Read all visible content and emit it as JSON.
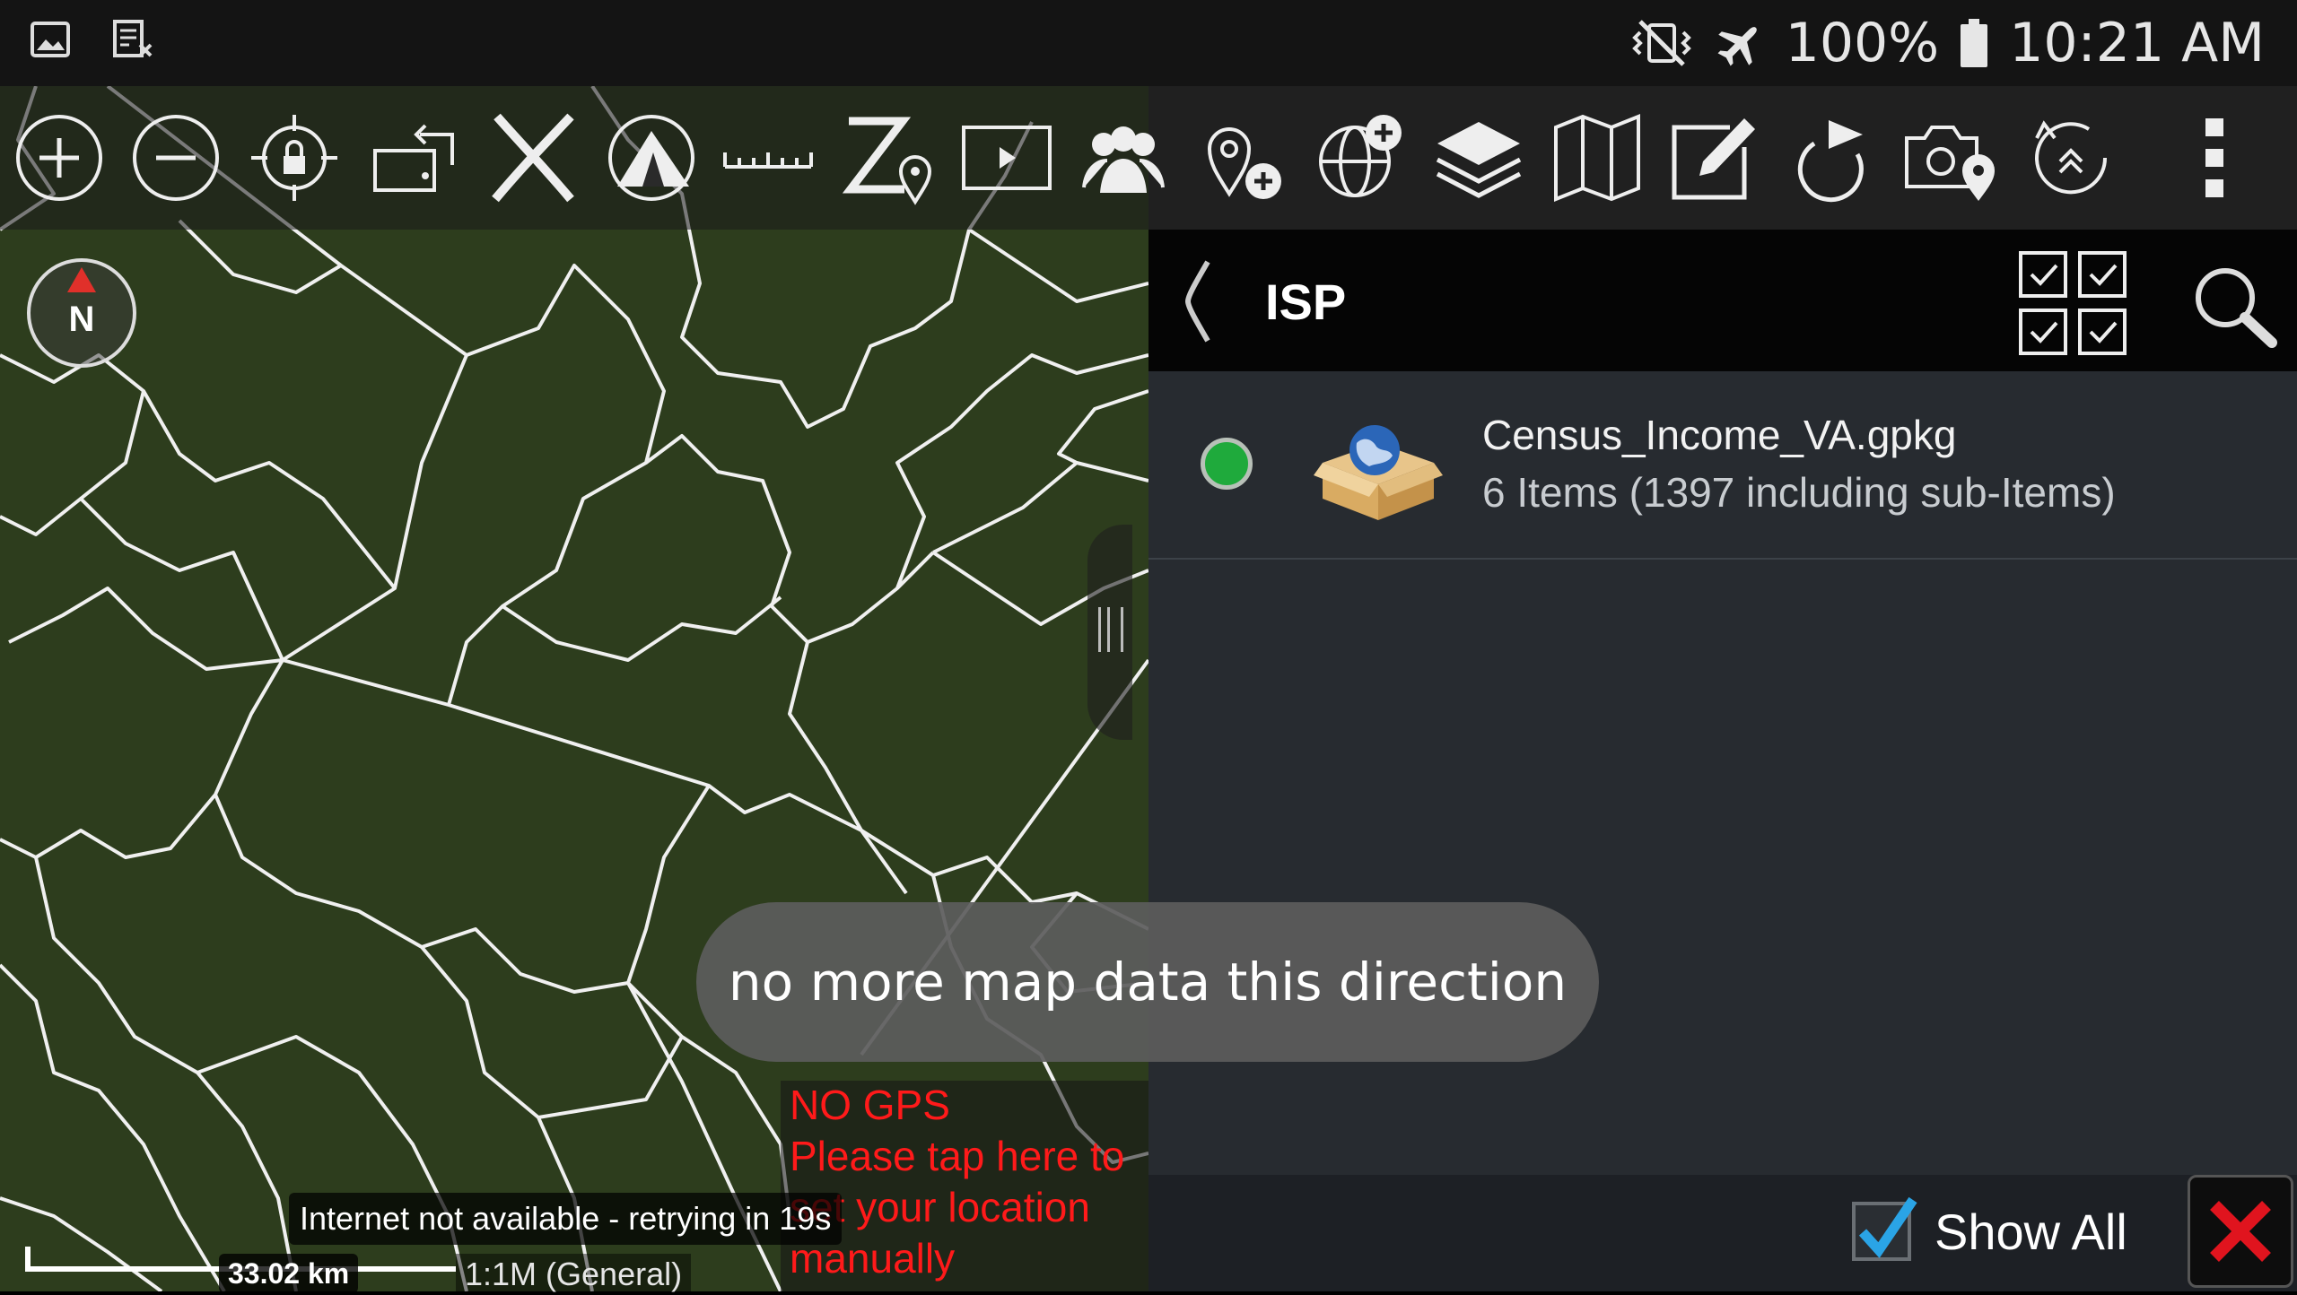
{
  "status_bar": {
    "battery": "100%",
    "time": "10:21 AM",
    "icons": [
      "image-icon",
      "screenshot-icon",
      "vibrate-mute-icon",
      "airplane-mode-icon",
      "battery-icon"
    ]
  },
  "toolbar": {
    "icons": [
      "zoom-in-icon",
      "zoom-out-icon",
      "lock-location-icon",
      "rotate-map-icon",
      "cancel-icon",
      "tent-icon",
      "measure-ruler-icon",
      "z-pin-icon",
      "play-video-icon",
      "contacts-icon",
      "add-point-icon",
      "add-overlay-icon",
      "layers-icon",
      "map-icon",
      "edit-icon",
      "route-icon",
      "camera-location-icon",
      "refresh-icon",
      "more-icon"
    ]
  },
  "map": {
    "scale_distance": "33.02 km",
    "scale_zoom": "1:1M (General)",
    "internet_notice": "Internet not available - retrying in 19s",
    "gps_warning": [
      "NO GPS",
      "Please tap here to",
      "set your location",
      "manually"
    ],
    "compass_label": "N",
    "toast": "no more map data this direction",
    "background_color": "#2d3d1d"
  },
  "panel": {
    "title": "ISP",
    "items": [
      {
        "name": "Census_Income_VA.gpkg",
        "description": "6 Items (1397 including sub-Items)",
        "status_color": "#1faa3c"
      }
    ],
    "footer": {
      "show_all_label": "Show All",
      "show_all_checked": true
    }
  }
}
